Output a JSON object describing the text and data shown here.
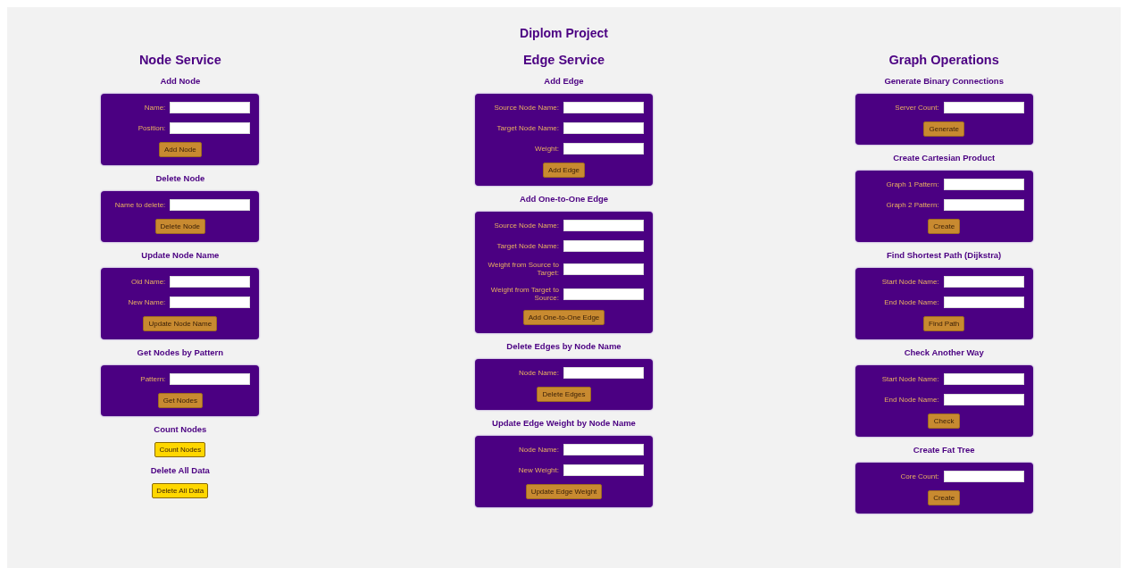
{
  "title": "Diplom Project",
  "columns": [
    {
      "title": "Node Service",
      "sections": [
        {
          "kind": "form",
          "title": "Add Node",
          "fields": [
            {
              "label": "Name:"
            },
            {
              "label": "Position:"
            }
          ],
          "button": "Add Node"
        },
        {
          "kind": "form",
          "title": "Delete Node",
          "fields": [
            {
              "label": "Name to delete:"
            }
          ],
          "button": "Delete Node"
        },
        {
          "kind": "form",
          "title": "Update Node Name",
          "fields": [
            {
              "label": "Old Name:"
            },
            {
              "label": "New Name:"
            }
          ],
          "button": "Update Node Name"
        },
        {
          "kind": "form",
          "title": "Get Nodes by Pattern",
          "fields": [
            {
              "label": "Pattern:"
            }
          ],
          "button": "Get Nodes"
        },
        {
          "kind": "action",
          "title": "Count Nodes",
          "button": "Count Nodes"
        },
        {
          "kind": "action",
          "title": "Delete All Data",
          "button": "Delete All Data"
        }
      ]
    },
    {
      "title": "Edge Service",
      "sections": [
        {
          "kind": "form",
          "title": "Add Edge",
          "fields": [
            {
              "label": "Source Node Name:"
            },
            {
              "label": "Target Node Name:"
            },
            {
              "label": "Weight:"
            }
          ],
          "button": "Add Edge"
        },
        {
          "kind": "form",
          "title": "Add One-to-One Edge",
          "fields": [
            {
              "label": "Source Node Name:"
            },
            {
              "label": "Target Node Name:"
            },
            {
              "label": "Weight from Source to Target:"
            },
            {
              "label": "Weight from Target to Source:"
            }
          ],
          "button": "Add One-to-One Edge"
        },
        {
          "kind": "form",
          "title": "Delete Edges by Node Name",
          "fields": [
            {
              "label": "Node Name:"
            }
          ],
          "button": "Delete Edges"
        },
        {
          "kind": "form",
          "title": "Update Edge Weight by Node Name",
          "fields": [
            {
              "label": "Node Name:"
            },
            {
              "label": "New Weight:"
            }
          ],
          "button": "Update Edge Weight"
        }
      ]
    },
    {
      "title": "Graph Operations",
      "sections": [
        {
          "kind": "form",
          "title": "Generate Binary Connections",
          "fields": [
            {
              "label": "Server Count:"
            }
          ],
          "button": "Generate"
        },
        {
          "kind": "form",
          "title": "Create Cartesian Product",
          "fields": [
            {
              "label": "Graph 1 Pattern:"
            },
            {
              "label": "Graph 2 Pattern:"
            }
          ],
          "button": "Create"
        },
        {
          "kind": "form",
          "title": "Find Shortest Path (Dijkstra)",
          "fields": [
            {
              "label": "Start Node Name:"
            },
            {
              "label": "End Node Name:"
            }
          ],
          "button": "Find Path"
        },
        {
          "kind": "form",
          "title": "Check Another Way",
          "fields": [
            {
              "label": "Start Node Name:"
            },
            {
              "label": "End Node Name:"
            }
          ],
          "button": "Check"
        },
        {
          "kind": "form",
          "title": "Create Fat Tree",
          "fields": [
            {
              "label": "Core Count:"
            }
          ],
          "button": "Create"
        }
      ]
    }
  ]
}
